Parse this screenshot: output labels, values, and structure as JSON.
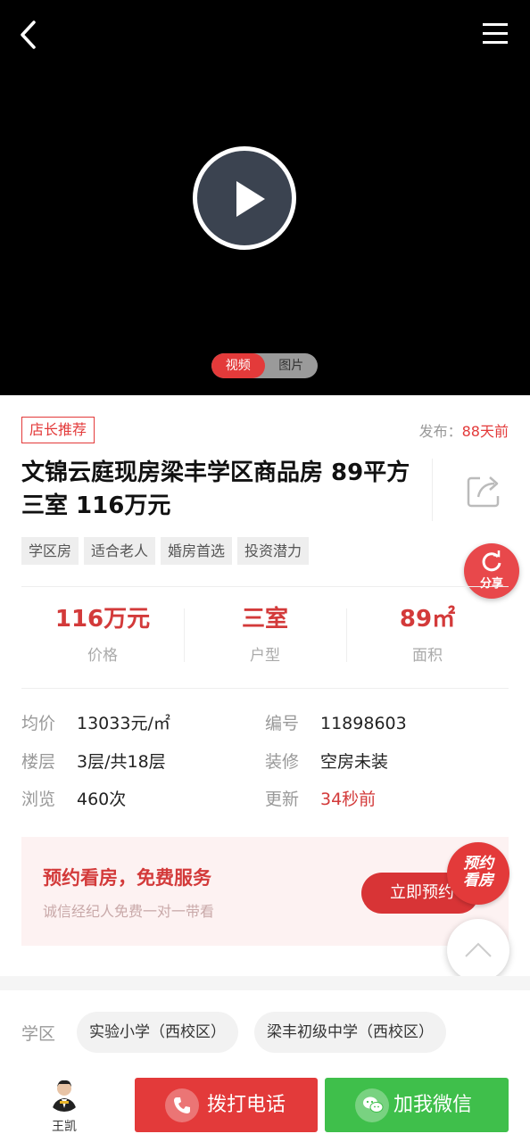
{
  "media": {
    "tabs": [
      "视频",
      "图片"
    ],
    "active_tab": "视频"
  },
  "listing": {
    "badge": "店长推荐",
    "publish_label": "发布：",
    "publish_value": "88天前",
    "title": "文锦云庭现房梁丰学区商品房 89平方 三室 116万元",
    "tags": [
      "学区房",
      "适合老人",
      "婚房首选",
      "投资潜力"
    ],
    "share_label": "分享"
  },
  "stats": [
    {
      "value": "116万元",
      "label": "价格"
    },
    {
      "value": "三室",
      "label": "户型"
    },
    {
      "value": "89",
      "unit": "㎡",
      "label": "面积"
    }
  ],
  "details": {
    "unit_price_key": "均价",
    "unit_price": "13033元/㎡",
    "code_key": "编号",
    "code": "11898603",
    "floor_key": "楼层",
    "floor": "3层/共18层",
    "decoration_key": "装修",
    "decoration": "空房未装",
    "views_key": "浏览",
    "views": "460次",
    "update_key": "更新",
    "update": "34秒前"
  },
  "appointment": {
    "heading": "预约看房，免费服务",
    "sub": "诚信经纪人免费一对一带看",
    "button": "立即预约",
    "badge_line1": "预约",
    "badge_line2": "看房"
  },
  "schools": {
    "label": "学区",
    "items": [
      "实验小学（西校区）",
      "梁丰初级中学（西校区）"
    ]
  },
  "bottom": {
    "agent_name": "王凯",
    "call": "拨打电话",
    "wechat": "加我微信"
  },
  "colors": {
    "accent": "#e33a3a",
    "wechat": "#3fbf4b"
  }
}
